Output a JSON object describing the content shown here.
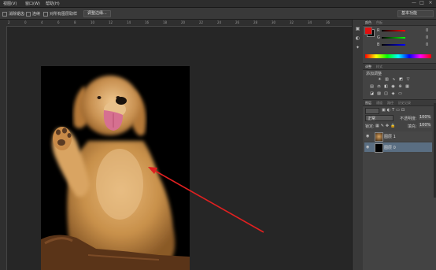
{
  "menubar": {
    "items": [
      "视图(V)",
      "窗口(W)",
      "帮助(H)"
    ],
    "window_controls": [
      "—",
      "□",
      "×"
    ]
  },
  "options_bar": {
    "item1": "消除锯齿",
    "item2": "连续",
    "item3": "对所有图层取样",
    "refine_button": "调整边缘...",
    "workspace": "基本功能"
  },
  "ruler_numbers": [
    "2",
    "0",
    "4",
    "6",
    "8",
    "10",
    "12",
    "14",
    "16",
    "18",
    "20",
    "22",
    "24",
    "26",
    "28",
    "30",
    "32",
    "34",
    "36"
  ],
  "panels": {
    "color_tabs": [
      "颜色",
      "色板"
    ],
    "color_rows": [
      {
        "label": "R",
        "value": "0"
      },
      {
        "label": "G",
        "value": "0"
      },
      {
        "label": "B",
        "value": "0"
      }
    ],
    "adjust_tabs": [
      "调整",
      "样式"
    ],
    "adjust_title": "添加调整",
    "layers_tabs": [
      "图层",
      "通道",
      "路径",
      "历史记录"
    ],
    "blend_mode": "正常",
    "opacity_label": "不透明度:",
    "opacity_value": "100%",
    "lock_label": "锁定:",
    "fill_label": "填充:",
    "fill_value": "100%",
    "layers": [
      {
        "name": "图层 1"
      },
      {
        "name": "图层 0"
      }
    ]
  },
  "colors": {
    "annotation": "#e02020",
    "selected_layer": "#5a6e82",
    "foreground": "#000000",
    "background_swatch": "#e01010"
  }
}
